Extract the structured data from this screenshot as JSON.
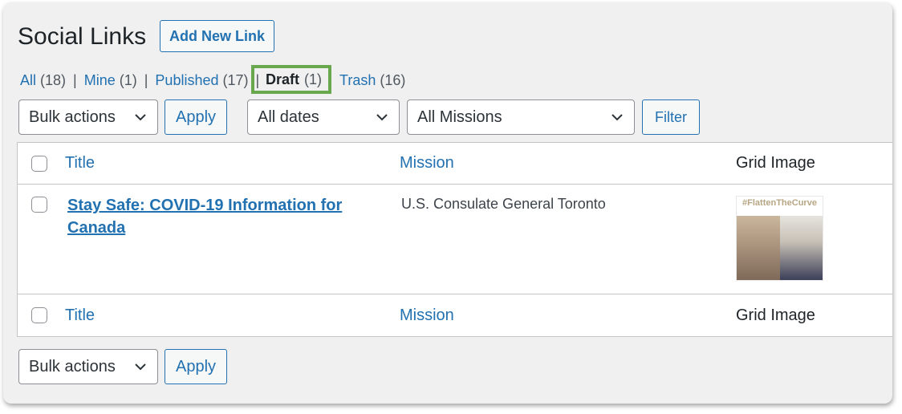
{
  "header": {
    "title": "Social Links",
    "add_new_label": "Add New Link"
  },
  "views": [
    {
      "label": "All",
      "count": "(18)"
    },
    {
      "label": "Mine",
      "count": "(1)"
    },
    {
      "label": "Published",
      "count": "(17)"
    },
    {
      "label": "Draft",
      "count": "(1)",
      "current": true
    },
    {
      "label": "Trash",
      "count": "(16)"
    }
  ],
  "filters": {
    "bulk_actions": "Bulk actions",
    "apply": "Apply",
    "dates": "All dates",
    "missions": "All Missions",
    "filter": "Filter"
  },
  "table": {
    "columns": {
      "title": "Title",
      "mission": "Mission",
      "grid_image": "Grid Image"
    },
    "rows": [
      {
        "title": "Stay Safe: COVID-19 Information for Canada",
        "mission": "U.S. Consulate General Toronto",
        "grid_image_text": "#FlattenTheCurve"
      }
    ]
  },
  "bottom": {
    "bulk_actions": "Bulk actions",
    "apply": "Apply"
  },
  "colors": {
    "link": "#2271b1",
    "highlight": "#6aa84f",
    "background": "#f0f0f1"
  }
}
